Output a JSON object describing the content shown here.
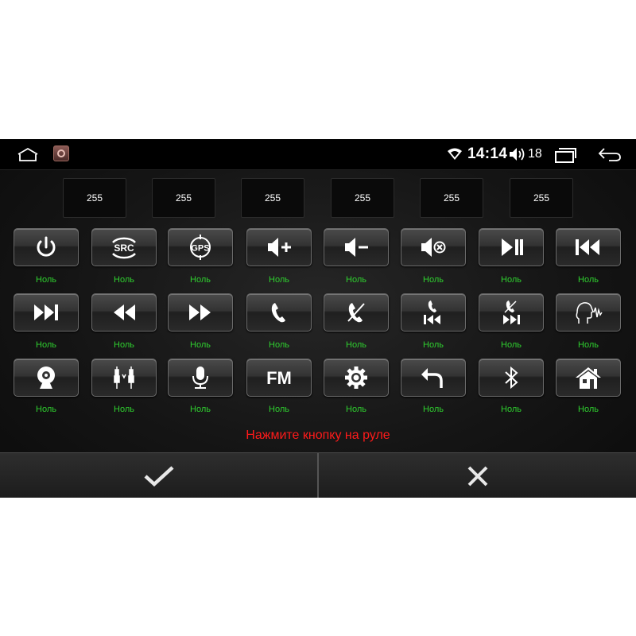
{
  "status_bar": {
    "time": "14:14",
    "volume_level": "18",
    "icons": [
      "home-icon",
      "app-icon",
      "wifi-icon",
      "volume-icon",
      "recents-icon",
      "back-icon"
    ]
  },
  "codes": [
    "255",
    "255",
    "255",
    "255",
    "255",
    "255"
  ],
  "buttons": [
    {
      "icon": "power-icon",
      "label": "Ноль"
    },
    {
      "icon": "src-icon",
      "text": "SRC",
      "label": "Ноль"
    },
    {
      "icon": "gps-icon",
      "text": "GPS",
      "label": "Ноль"
    },
    {
      "icon": "volume-up-icon",
      "label": "Ноль"
    },
    {
      "icon": "volume-down-icon",
      "label": "Ноль"
    },
    {
      "icon": "mute-icon",
      "label": "Ноль"
    },
    {
      "icon": "play-pause-icon",
      "label": "Ноль"
    },
    {
      "icon": "previous-track-icon",
      "label": "Ноль"
    },
    {
      "icon": "next-track-icon",
      "label": "Ноль"
    },
    {
      "icon": "rewind-icon",
      "label": "Ноль"
    },
    {
      "icon": "fast-forward-icon",
      "label": "Ноль"
    },
    {
      "icon": "phone-answer-icon",
      "label": "Ноль"
    },
    {
      "icon": "phone-hangup-icon",
      "label": "Ноль"
    },
    {
      "icon": "phone-previous-icon",
      "label": "Ноль"
    },
    {
      "icon": "phone-next-icon",
      "label": "Ноль"
    },
    {
      "icon": "voice-command-icon",
      "label": "Ноль"
    },
    {
      "icon": "camera-icon",
      "label": "Ноль"
    },
    {
      "icon": "rca-av-icon",
      "label": "Ноль"
    },
    {
      "icon": "microphone-icon",
      "label": "Ноль"
    },
    {
      "icon": "fm-icon",
      "text": "FM",
      "label": "Ноль"
    },
    {
      "icon": "settings-gear-icon",
      "label": "Ноль"
    },
    {
      "icon": "return-icon",
      "label": "Ноль"
    },
    {
      "icon": "bluetooth-icon",
      "label": "Ноль"
    },
    {
      "icon": "home-icon",
      "label": "Ноль"
    }
  ],
  "prompt": "Нажмите кнопку на руле",
  "footer": {
    "confirm_icon": "checkmark-icon",
    "cancel_icon": "close-icon"
  },
  "colors": {
    "label_green": "#2fd02f",
    "prompt_red": "#ff1a1a",
    "icon_white": "#ffffff"
  }
}
